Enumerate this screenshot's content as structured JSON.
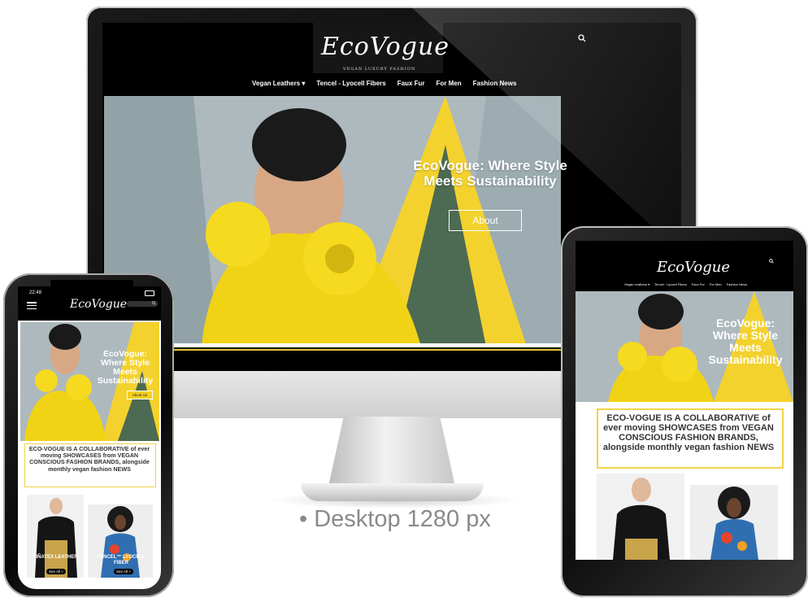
{
  "caption": "• Desktop 1280 px",
  "brand": {
    "logo": "EcoVogue",
    "tagline": "VEGAN LUXURY  FASHION"
  },
  "desktop": {
    "nav": [
      "Vegan Leathers ▾",
      "Tencel - Lyocell Fibers",
      "Faux Fur",
      "For Men",
      "Fashion News"
    ],
    "hero_title": "EcoVogue: Where Style Meets Sustainability",
    "hero_button": "About"
  },
  "tablet": {
    "nav": [
      "Vegan Leathers ▾",
      "Tencel · Lyocell Fibers",
      "Faux Fur",
      "For Men",
      "Fashion News"
    ],
    "hero_title": "EcoVogue: Where Style Meets Sustainability",
    "intro": "ECO-VOGUE IS A COLLABORATIVE of ever moving SHOWCASES from VEGAN CONSCIOUS FASHION BRANDS, alongside monthly vegan fashion NEWS"
  },
  "phone": {
    "time": "22:48",
    "hero_title": "EcoVogue: Where Style Meets Sustainability",
    "hero_button": "About Us",
    "intro": "ECO-VOGUE IS A COLLABORATIVE of ever moving SHOWCASES from VEGAN CONSCIOUS FASHION BRANDS, alongside monthly vegan fashion NEWS",
    "cards": [
      {
        "label": "PIÑATEX LEATHER",
        "button": "See All >"
      },
      {
        "label": "TENCEL™ LYOCELL FIBER",
        "button": "See All >"
      }
    ]
  },
  "colors": {
    "accent_yellow": "#f3cf21",
    "box_border": "#f1d34a",
    "background": "#ffffff",
    "site_header": "#000000"
  },
  "icons": [
    "search-icon",
    "menu-icon",
    "battery-icon",
    "chevron-down-icon"
  ]
}
